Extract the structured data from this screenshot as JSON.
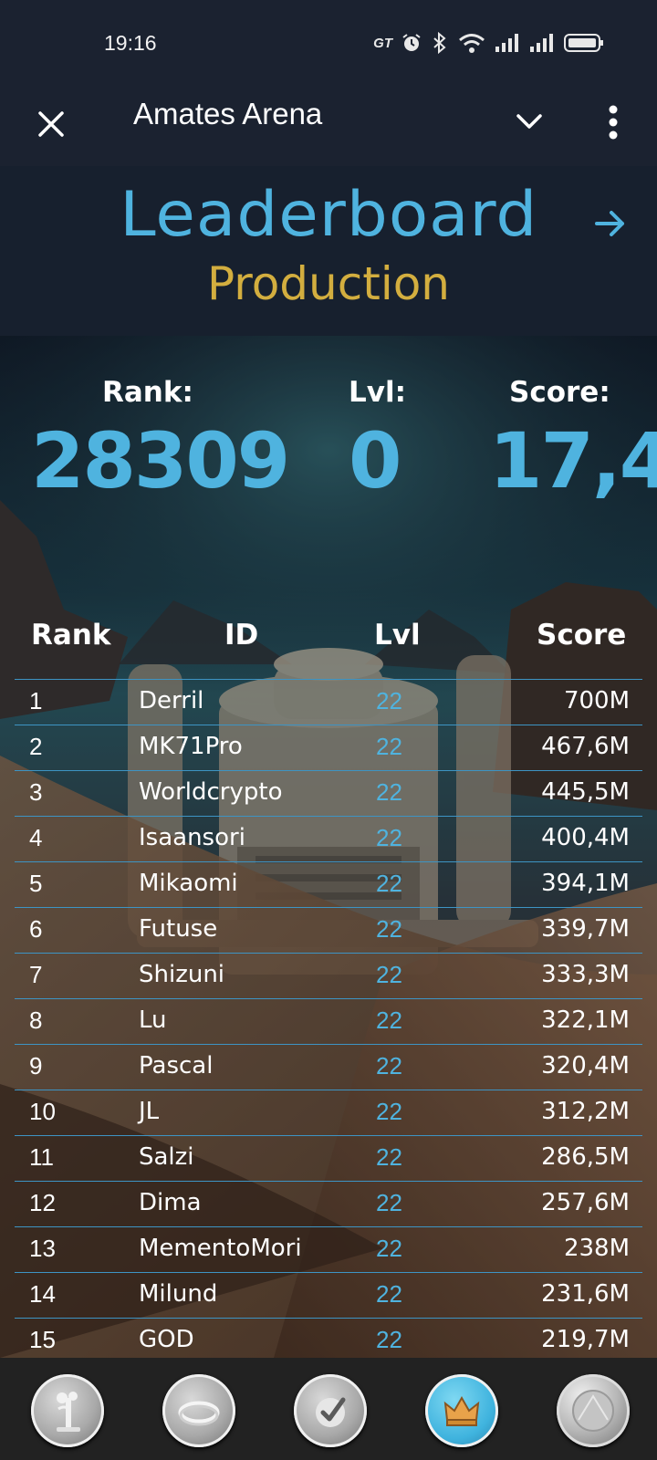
{
  "status_bar": {
    "time": "19:16",
    "carrier_tag": "GT",
    "icons": [
      "alarm-icon",
      "bluetooth-icon",
      "wifi-icon",
      "signal-icon",
      "signal-icon",
      "battery-icon"
    ]
  },
  "app_bar": {
    "title": "Amates Arena",
    "icons": [
      "close-icon",
      "chevron-down-icon",
      "more-vert-icon"
    ]
  },
  "header": {
    "title": "Leaderboard",
    "subtitle": "Production",
    "title_color": "#4fb3df",
    "subtitle_color": "#d3ae3f"
  },
  "player_stats": {
    "rank_label": "Rank:",
    "rank_value": "28309",
    "level_label": "Lvl:",
    "level_value": "0",
    "score_label": "Score:",
    "score_value": "17,4"
  },
  "table": {
    "headers": {
      "rank": "Rank",
      "id": "ID",
      "level": "Lvl",
      "score": "Score"
    },
    "rows": [
      {
        "rank": "1",
        "id": "Derril",
        "level": "22",
        "score": "700M"
      },
      {
        "rank": "2",
        "id": "MK71Pro",
        "level": "22",
        "score": "467,6M"
      },
      {
        "rank": "3",
        "id": "Worldcrypto",
        "level": "22",
        "score": "445,5M"
      },
      {
        "rank": "4",
        "id": "Isaansori",
        "level": "22",
        "score": "400,4M"
      },
      {
        "rank": "5",
        "id": "Mikaomi",
        "level": "22",
        "score": "394,1M"
      },
      {
        "rank": "6",
        "id": "Futuse",
        "level": "22",
        "score": "339,7M"
      },
      {
        "rank": "7",
        "id": "Shizuni",
        "level": "22",
        "score": "333,3M"
      },
      {
        "rank": "8",
        "id": "Lu",
        "level": "22",
        "score": "322,1M"
      },
      {
        "rank": "9",
        "id": "Pascal",
        "level": "22",
        "score": "320,4M"
      },
      {
        "rank": "10",
        "id": "JL",
        "level": "22",
        "score": "312,2M"
      },
      {
        "rank": "11",
        "id": "Salzi",
        "level": "22",
        "score": "286,5M"
      },
      {
        "rank": "12",
        "id": "Dima",
        "level": "22",
        "score": "257,6M"
      },
      {
        "rank": "13",
        "id": "MementoMori",
        "level": "22",
        "score": "238M"
      },
      {
        "rank": "14",
        "id": "Milund",
        "level": "22",
        "score": "231,6M"
      },
      {
        "rank": "15",
        "id": "GOD",
        "level": "22",
        "score": "219,7M"
      }
    ]
  },
  "bottom_nav": {
    "items": [
      {
        "icon": "mining-drill-icon",
        "active": false
      },
      {
        "icon": "ring-arena-icon",
        "active": false
      },
      {
        "icon": "tasks-check-icon",
        "active": false
      },
      {
        "icon": "crown-icon",
        "active": true
      },
      {
        "icon": "coin-icon",
        "active": false
      }
    ]
  }
}
